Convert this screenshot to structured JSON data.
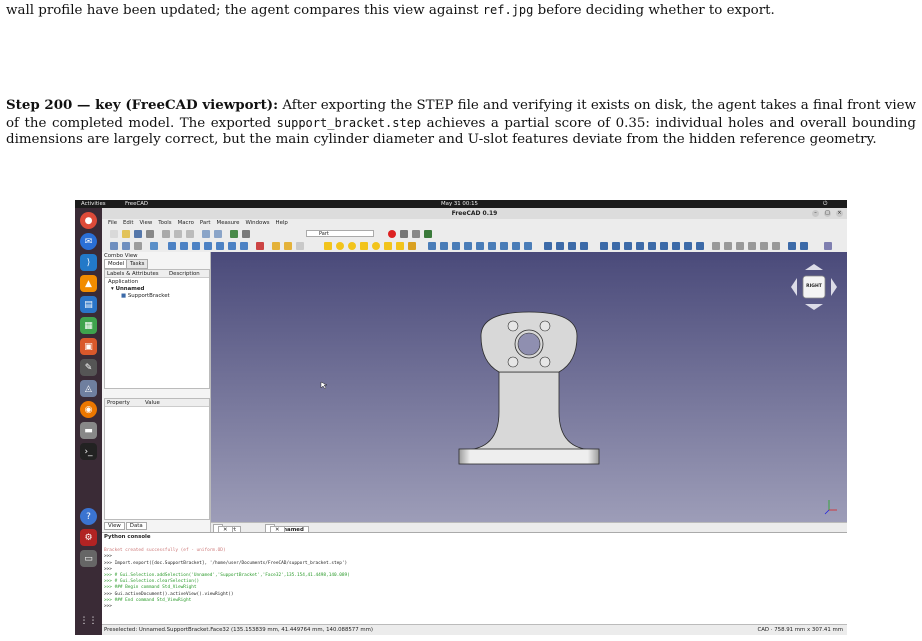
{
  "paragraph1": {
    "text_start": "wall profile have been updated; the agent compares this view against ",
    "ref_file": "ref.jpg",
    "text_end": " before deciding whether to export."
  },
  "paragraph2": {
    "label": "Step 200 — key (FreeCAD viewport):",
    "text_a": " After exporting the STEP file and verifying it exists on disk, the agent takes a final front view of the completed model. The exported ",
    "file": "support_bracket.step",
    "text_b": " achieves a partial score of 0.35: individual holes and overall bounding dimensions are largely correct, but the main cylinder diameter and U-slot features deviate from the hidden reference geometry."
  },
  "screenshot": {
    "topbar": {
      "activities": "Activities",
      "app": "FreeCAD",
      "clock": "May 31  00:15"
    },
    "window_title": "FreeCAD 0.19",
    "menu": [
      "File",
      "Edit",
      "View",
      "Tools",
      "Macro",
      "Part",
      "Measure",
      "Windows",
      "Help"
    ],
    "workbench": "Part",
    "combo_view": {
      "title": "Combo View",
      "tabs": [
        "Model",
        "Tasks"
      ],
      "tree_headers": [
        "Labels & Attributes",
        "Description"
      ],
      "tree_items": [
        "Application",
        "Unnamed",
        "SupportBracket"
      ],
      "prop_headers": [
        "Property",
        "Value"
      ],
      "bottom_tabs": [
        "View",
        "Data"
      ]
    },
    "nav_cube_face": "RIGHT",
    "doc_tabs": [
      "Start page",
      "Unnamed : 1*"
    ],
    "console": {
      "title": "Python console",
      "lines": [
        "Bracket created successfully (ef - uniform.OD)",
        ">>> ",
        ">>> Import.export([doc.SupportBracket], '/home/user/Documents/FreeCAD/support_bracket.step')",
        ">>> ",
        ">>> # Gui.Selection.addSelection('Unnamed','SupportBracket','Face32',135.154,41.4498,140.089)",
        ">>> # Gui.Selection.clearSelection()",
        ">>> ### Begin command Std_ViewRight",
        ">>> Gui.activeDocument().activeView().viewRight()",
        ">>> ### End command Std_ViewRight",
        ">>> "
      ]
    },
    "status_left": "Preselected: Unnamed.SupportBracket.Face32 (135.153839 mm, 41.449764 mm, 140.088577 mm)",
    "status_right": "CAD  ·  758.91 mm x 307.41 mm"
  }
}
